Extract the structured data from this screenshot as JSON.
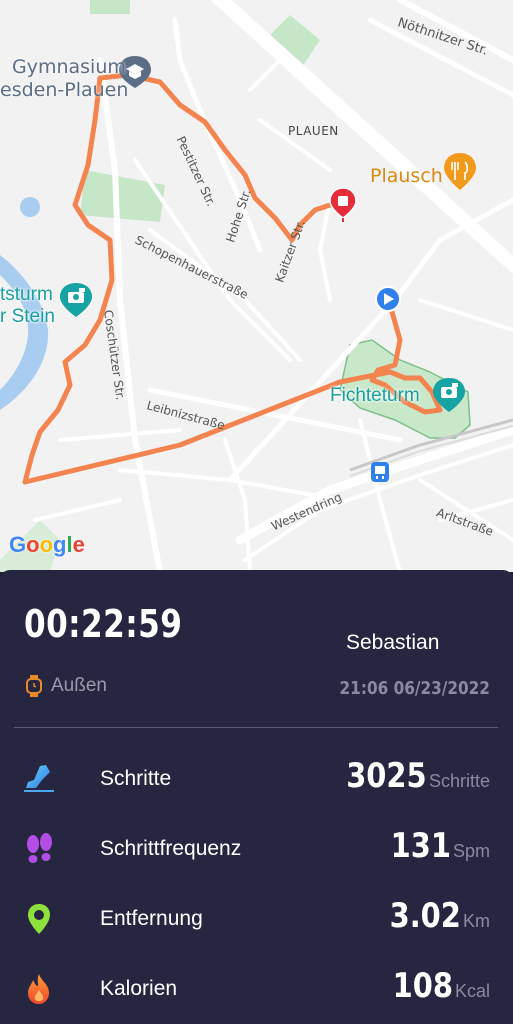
{
  "map": {
    "labels": {
      "gymnasium_line1": "Gymnasium",
      "gymnasium_line2": "esden-Plauen",
      "plauen": "PLAUEN",
      "plausch": "Plausch",
      "noethnitzer": "Nöthnitzer Str.",
      "pestitzer": "Pestitzer Str.",
      "hohe": "Hohe Str.",
      "kaitzer": "Kaitzer Str.",
      "schopenhauer": "Schopenhauerstraße",
      "coschuetzer": "Coschützer Str.",
      "leibniz": "Leibnizstraße",
      "westendring": "Westendring",
      "arlt": "Arltstraße",
      "fichteturm": "Fichteturm",
      "poi_left_line1": "tsturm",
      "poi_left_line2": "r Stein"
    },
    "google_logo": [
      "G",
      "o",
      "o",
      "g",
      "l",
      "e"
    ],
    "google_colors": [
      "#4285F4",
      "#EA4335",
      "#FBBC05",
      "#4285F4",
      "#34A853",
      "#EA4335"
    ],
    "route_color": "#f4844f"
  },
  "workout": {
    "duration": "00:22:59",
    "user": "Sebastian",
    "mode": "Außen",
    "datetime": "21:06 06/23/2022"
  },
  "stats": [
    {
      "label": "Schritte",
      "value": "3025",
      "unit": "Schritte",
      "icon": "shoe-icon"
    },
    {
      "label": "Schrittfrequenz",
      "value": "131",
      "unit": "Spm",
      "icon": "footprints-icon"
    },
    {
      "label": "Entfernung",
      "value": "3.02",
      "unit": "Km",
      "icon": "location-pin-icon"
    },
    {
      "label": "Kalorien",
      "value": "108",
      "unit": "Kcal",
      "icon": "flame-icon"
    }
  ]
}
